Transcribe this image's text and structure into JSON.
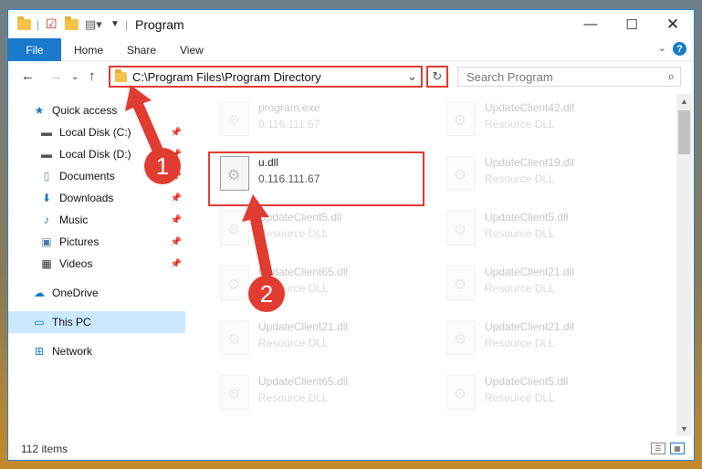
{
  "window": {
    "title": "Program"
  },
  "ribbon": {
    "file": "File",
    "tabs": [
      "Home",
      "Share",
      "View"
    ],
    "help": "?"
  },
  "nav": {
    "address": "C:\\Program Files\\Program Directory",
    "search_placeholder": "Search Program"
  },
  "sidebar": {
    "items": [
      {
        "label": "Quick access",
        "icon": "star-icon"
      },
      {
        "label": "Local Disk (C:)",
        "icon": "drive-icon"
      },
      {
        "label": "Local Disk (D:)",
        "icon": "drive-icon"
      },
      {
        "label": "Documents",
        "icon": "documents-icon"
      },
      {
        "label": "Downloads",
        "icon": "download-icon"
      },
      {
        "label": "Music",
        "icon": "music-icon"
      },
      {
        "label": "Pictures",
        "icon": "pictures-icon"
      },
      {
        "label": "Videos",
        "icon": "videos-icon"
      },
      {
        "label": "OneDrive",
        "icon": "cloud-icon"
      },
      {
        "label": "This PC",
        "icon": "computer-icon"
      },
      {
        "label": "Network",
        "icon": "network-icon"
      }
    ]
  },
  "files": {
    "col1": [
      {
        "name": "program.exe",
        "desc": "0.116.111.67"
      },
      {
        "name": "u.dll",
        "desc": "0.116.111.67"
      },
      {
        "name": "UpdateClient5.dll",
        "desc": "Resource DLL"
      },
      {
        "name": "UpdateClient65.dll",
        "desc": "Resource DLL"
      },
      {
        "name": "UpdateClient21.dll",
        "desc": "Resource DLL"
      },
      {
        "name": "UpdateClient65.dll",
        "desc": "Resource DLL"
      }
    ],
    "col2": [
      {
        "name": "UpdateClient42.dll",
        "desc": "Resource DLL"
      },
      {
        "name": "UpdateClient19.dll",
        "desc": "Resource DLL"
      },
      {
        "name": "UpdateClient5.dll",
        "desc": "Resource DLL"
      },
      {
        "name": "UpdateClient21.dll",
        "desc": "Resource DLL"
      },
      {
        "name": "UpdateClient21.dll",
        "desc": "Resource DLL"
      },
      {
        "name": "UpdateClient5.dll",
        "desc": "Resource DLL"
      }
    ]
  },
  "status": {
    "items": "112 items"
  },
  "annotations": {
    "step1": "1",
    "step2": "2"
  },
  "colors": {
    "accent": "#1979ca",
    "annotation": "#e03c31"
  }
}
